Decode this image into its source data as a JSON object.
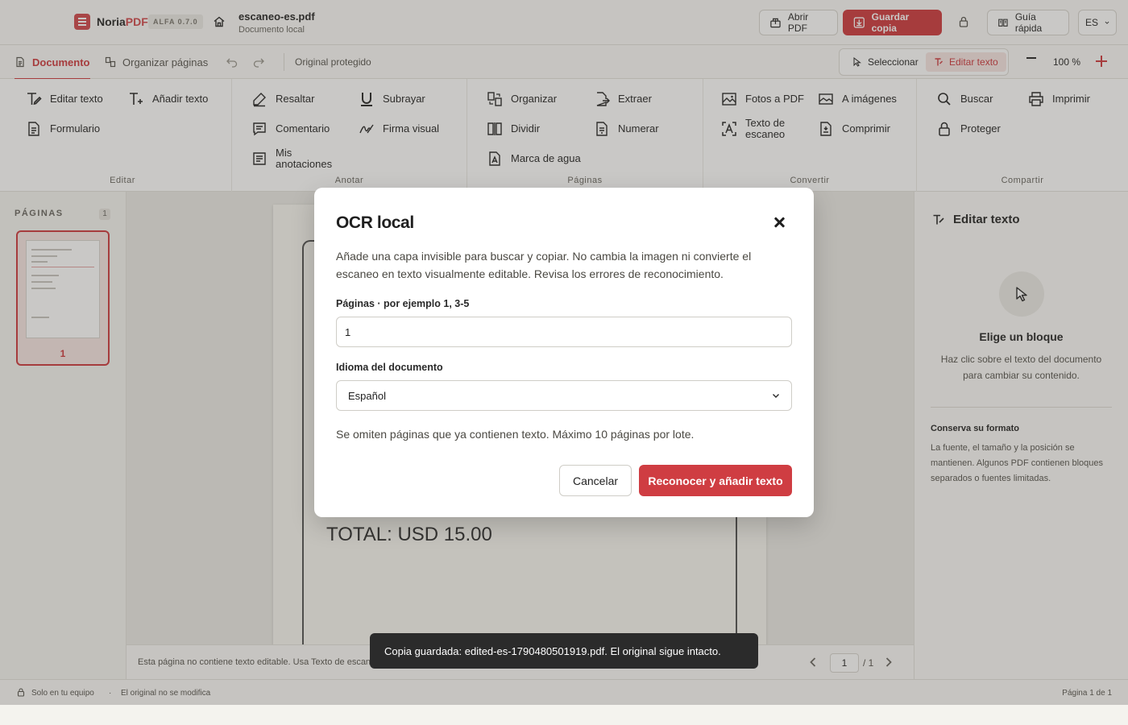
{
  "header": {
    "brand_main": "Noria",
    "brand_accent": "PDF",
    "version": "ALFA 0.7.0",
    "file_name": "escaneo-es.pdf",
    "file_sub": "Documento local",
    "open_label": "Abrir PDF",
    "save_label": "Guardar copia",
    "guide_label": "Guía rápida",
    "language": "ES"
  },
  "toolbar": {
    "tab_document": "Documento",
    "tab_organize": "Organizar páginas",
    "status": "Original protegido",
    "mode_select": "Seleccionar",
    "mode_edit": "Editar texto",
    "zoom": "100 %"
  },
  "ribbon": {
    "groups": [
      {
        "label": "Editar",
        "items": [
          "Editar texto",
          "Añadir texto",
          "Formulario"
        ]
      },
      {
        "label": "Anotar",
        "items": [
          "Resaltar",
          "Subrayar",
          "Comentario",
          "Firma visual",
          "Mis anotaciones"
        ]
      },
      {
        "label": "Páginas",
        "items": [
          "Organizar",
          "Extraer",
          "Dividir",
          "Numerar",
          "Marca de agua"
        ]
      },
      {
        "label": "Convertir",
        "items": [
          "Fotos a PDF",
          "A imágenes",
          "Texto de escaneo",
          "Comprimir"
        ]
      },
      {
        "label": "Compartir",
        "items": [
          "Buscar",
          "Imprimir",
          "Proteger"
        ]
      }
    ]
  },
  "pages_panel": {
    "title": "PÁGINAS",
    "count": "1",
    "thumbs": [
      {
        "number": "1"
      }
    ]
  },
  "document": {
    "total_text": "TOTAL: USD 15.00"
  },
  "canvas_footer": {
    "hint": "Esta página no contiene texto editable. Usa Texto de escaneo",
    "page_input": "1",
    "page_total": "/ 1"
  },
  "right_panel": {
    "title": "Editar texto",
    "heading": "Elige un bloque",
    "description": "Haz clic sobre el texto del documento para cambiar su contenido.",
    "sub_title": "Conserva su formato",
    "sub_description": "La fuente, el tamaño y la posición se mantienen. Algunos PDF contienen bloques separados o fuentes limitadas."
  },
  "footer": {
    "local": "Solo en tu equipo",
    "dot": "·",
    "original": "El original no se modifica",
    "page": "Página 1 de 1"
  },
  "modal": {
    "title": "OCR local",
    "description": "Añade una capa invisible para buscar y copiar. No cambia la imagen ni convierte el escaneo en texto visualmente editable. Revisa los errores de reconocimiento.",
    "pages_label": "Páginas · por ejemplo 1, 3-5",
    "pages_value": "1",
    "language_label": "Idioma del documento",
    "language_value": "Español",
    "note": "Se omiten páginas que ya contienen texto. Máximo 10 páginas por lote.",
    "cancel_label": "Cancelar",
    "confirm_label": "Reconocer y añadir texto"
  },
  "toast": {
    "message": "Copia guardada: edited-es-1790480501919.pdf. El original sigue intacto."
  },
  "colors": {
    "accent": "#cf3d42",
    "toast_bg": "#2b2b2b"
  }
}
